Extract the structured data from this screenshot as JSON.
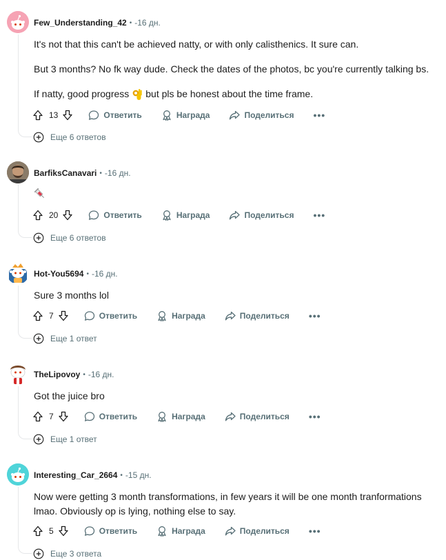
{
  "comments": [
    {
      "username": "Few_Understanding_42",
      "time": "-16 дн.",
      "avatar": "reddit-snoo-pink",
      "paragraphs": [
        "It's not that this can't be achieved natty, or with only calisthenics. It sure can.",
        "But 3 months? No fk way dude. Check the dates of the photos, bc you're currently talking bs.",
        "If natty, good progress",
        "but pls be honest about the time frame."
      ],
      "votes": "13",
      "reply": "Ответить",
      "award": "Награда",
      "share": "Поделиться",
      "more_replies": "Еще 6 ответов"
    },
    {
      "username": "BarfiksCanavari",
      "time": "-16 дн.",
      "avatar": "photo-avatar",
      "votes": "20",
      "reply": "Ответить",
      "award": "Награда",
      "share": "Поделиться",
      "more_replies": "Еще 6 ответов"
    },
    {
      "username": "Hot-You5694",
      "time": "-16 дн.",
      "avatar": "reddit-snoo-custom",
      "paragraphs": [
        "Sure 3 months lol"
      ],
      "votes": "7",
      "reply": "Ответить",
      "award": "Награда",
      "share": "Поделиться",
      "more_replies": "Еще 1 ответ"
    },
    {
      "username": "TheLipovoy",
      "time": "-16 дн.",
      "avatar": "reddit-snoo-custom-red",
      "paragraphs": [
        "Got the juice bro"
      ],
      "votes": "7",
      "reply": "Ответить",
      "award": "Награда",
      "share": "Поделиться",
      "more_replies": "Еще 1 ответ"
    },
    {
      "username": "Interesting_Car_2664",
      "time": "-15 дн.",
      "avatar": "reddit-snoo-teal",
      "paragraphs": [
        "Now were getting 3 month transformations, in few years it will be one month tranformations",
        "lmao. Obviously op is lying, nothing else to say."
      ],
      "votes": "5",
      "reply": "Ответить",
      "award": "Награда",
      "share": "Поделиться",
      "more_replies": "Еще 3 ответа"
    }
  ],
  "icons": {
    "upvote": "upvote-arrow-icon",
    "downvote": "downvote-arrow-icon",
    "reply": "speech-bubble-icon",
    "award": "award-ribbon-icon",
    "share": "share-arrow-icon",
    "more": "ellipsis-icon",
    "expand": "plus-circle-icon"
  },
  "colors": {
    "text": "#1c1c1c",
    "meta": "#576f76",
    "thread_line": "#e5e7e9",
    "avatar_pink": "#f6a3b4",
    "avatar_teal": "#4fd4d9"
  }
}
